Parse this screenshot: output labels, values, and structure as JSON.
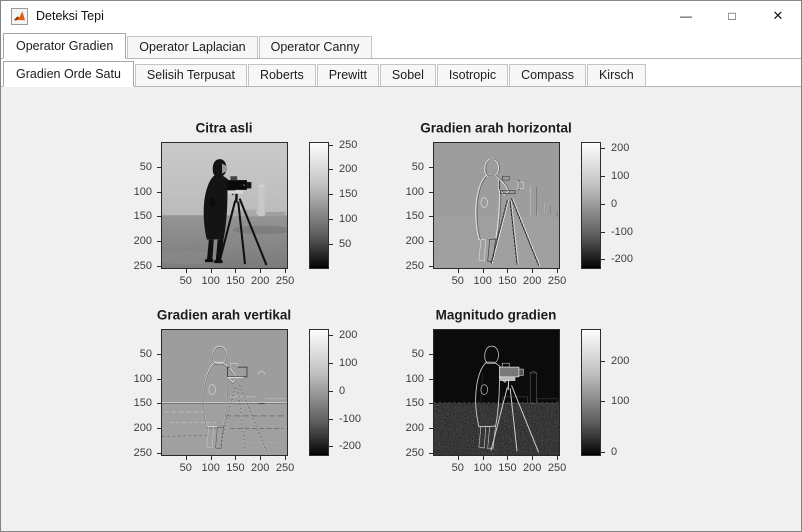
{
  "window": {
    "title": "Deteksi Tepi",
    "controls": {
      "minimize": "—",
      "maximize": "□",
      "close": "✕"
    }
  },
  "outer_tabs": [
    {
      "label": "Operator Gradien",
      "selected": true
    },
    {
      "label": "Operator Laplacian",
      "selected": false
    },
    {
      "label": "Operator Canny",
      "selected": false
    }
  ],
  "inner_tabs": [
    {
      "label": "Gradien Orde Satu",
      "selected": true
    },
    {
      "label": "Selisih Terpusat",
      "selected": false
    },
    {
      "label": "Roberts",
      "selected": false
    },
    {
      "label": "Prewitt",
      "selected": false
    },
    {
      "label": "Sobel",
      "selected": false
    },
    {
      "label": "Isotropic",
      "selected": false
    },
    {
      "label": "Compass",
      "selected": false
    },
    {
      "label": "Kirsch",
      "selected": false
    }
  ],
  "plots": [
    {
      "title": "Citra asli",
      "mode": "original",
      "x_ticks": [
        "50",
        "100",
        "150",
        "200",
        "250"
      ],
      "y_ticks": [
        "50",
        "100",
        "150",
        "200",
        "250"
      ],
      "tick_fracs": [
        0.195,
        0.391,
        0.586,
        0.781,
        0.977
      ],
      "colorbar_ticks": [
        {
          "label": "250",
          "pos": 0.02
        },
        {
          "label": "200",
          "pos": 0.216
        },
        {
          "label": "150",
          "pos": 0.412
        },
        {
          "label": "100",
          "pos": 0.608
        },
        {
          "label": "50",
          "pos": 0.804
        }
      ]
    },
    {
      "title": "Gradien arah horizontal",
      "mode": "gradient-h",
      "x_ticks": [
        "50",
        "100",
        "150",
        "200",
        "250"
      ],
      "y_ticks": [
        "50",
        "100",
        "150",
        "200",
        "250"
      ],
      "tick_fracs": [
        0.195,
        0.391,
        0.586,
        0.781,
        0.977
      ],
      "colorbar_ticks": [
        {
          "label": "200",
          "pos": 0.05
        },
        {
          "label": "100",
          "pos": 0.27
        },
        {
          "label": "0",
          "pos": 0.49
        },
        {
          "label": "-100",
          "pos": 0.71
        },
        {
          "label": "-200",
          "pos": 0.92
        }
      ]
    },
    {
      "title": "Gradien arah vertikal",
      "mode": "gradient-v",
      "x_ticks": [
        "50",
        "100",
        "150",
        "200",
        "250"
      ],
      "y_ticks": [
        "50",
        "100",
        "150",
        "200",
        "250"
      ],
      "tick_fracs": [
        0.195,
        0.391,
        0.586,
        0.781,
        0.977
      ],
      "colorbar_ticks": [
        {
          "label": "200",
          "pos": 0.05
        },
        {
          "label": "100",
          "pos": 0.27
        },
        {
          "label": "0",
          "pos": 0.49
        },
        {
          "label": "-100",
          "pos": 0.71
        },
        {
          "label": "-200",
          "pos": 0.92
        }
      ]
    },
    {
      "title": "Magnitudo gradien",
      "mode": "magnitude",
      "x_ticks": [
        "50",
        "100",
        "150",
        "200",
        "250"
      ],
      "y_ticks": [
        "50",
        "100",
        "150",
        "200",
        "250"
      ],
      "tick_fracs": [
        0.195,
        0.391,
        0.586,
        0.781,
        0.977
      ],
      "colorbar_ticks": [
        {
          "label": "200",
          "pos": 0.25
        },
        {
          "label": "100",
          "pos": 0.57
        },
        {
          "label": "0",
          "pos": 0.97
        }
      ]
    }
  ],
  "colors": {
    "content_bg": "#f0f0f0",
    "colorbar_top": "#ffffff",
    "colorbar_bottom": "#000000",
    "matlab_orange": "#e05c10"
  }
}
